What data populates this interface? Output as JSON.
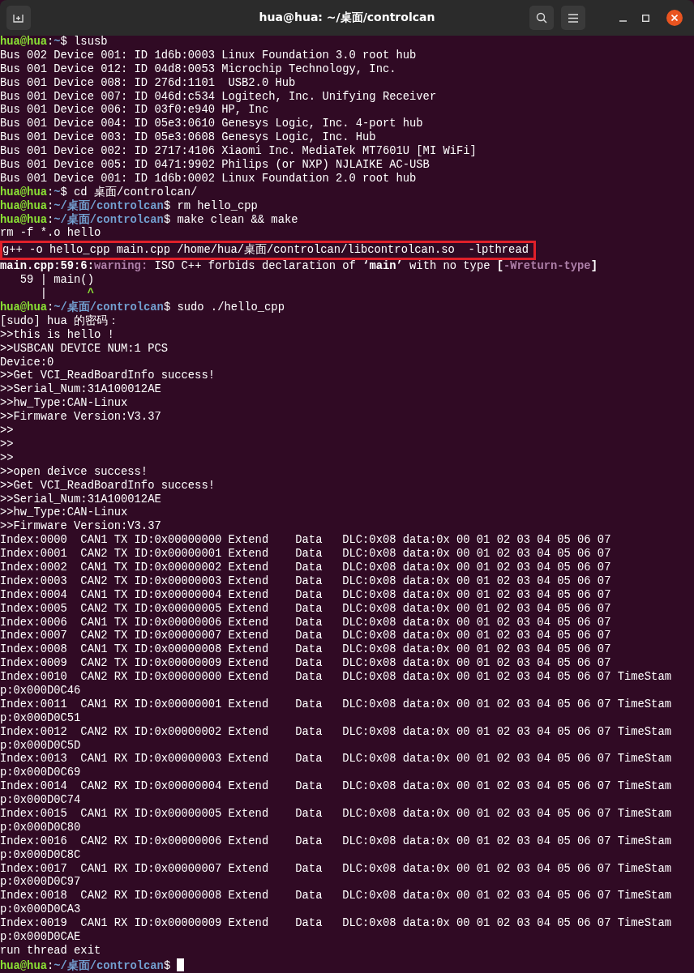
{
  "window": {
    "title": "hua@hua: ~/桌面/controlcan"
  },
  "terminal": {
    "lines": [
      {
        "kind": "prompt",
        "user": "hua@hua",
        "sep": ":",
        "path": "~",
        "symbol": "$ ",
        "command": "lsusb"
      },
      {
        "kind": "output",
        "text": "Bus 002 Device 001: ID 1d6b:0003 Linux Foundation 3.0 root hub"
      },
      {
        "kind": "output",
        "text": "Bus 001 Device 012: ID 04d8:0053 Microchip Technology, Inc."
      },
      {
        "kind": "output",
        "text": "Bus 001 Device 008: ID 276d:1101  USB2.0 Hub"
      },
      {
        "kind": "output",
        "text": "Bus 001 Device 007: ID 046d:c534 Logitech, Inc. Unifying Receiver"
      },
      {
        "kind": "output",
        "text": "Bus 001 Device 006: ID 03f0:e940 HP, Inc"
      },
      {
        "kind": "output",
        "text": "Bus 001 Device 004: ID 05e3:0610 Genesys Logic, Inc. 4-port hub"
      },
      {
        "kind": "output",
        "text": "Bus 001 Device 003: ID 05e3:0608 Genesys Logic, Inc. Hub"
      },
      {
        "kind": "output",
        "text": "Bus 001 Device 002: ID 2717:4106 Xiaomi Inc. MediaTek MT7601U [MI WiFi]"
      },
      {
        "kind": "output",
        "text": "Bus 001 Device 005: ID 0471:9902 Philips (or NXP) NJLAIKE AC-USB"
      },
      {
        "kind": "output",
        "text": "Bus 001 Device 001: ID 1d6b:0002 Linux Foundation 2.0 root hub"
      },
      {
        "kind": "prompt",
        "user": "hua@hua",
        "sep": ":",
        "path": "~",
        "symbol": "$ ",
        "command": "cd 桌面/controlcan/"
      },
      {
        "kind": "prompt",
        "user": "hua@hua",
        "sep": ":",
        "path": "~/桌面/controlcan",
        "symbol": "$ ",
        "command": "rm hello_cpp"
      },
      {
        "kind": "prompt",
        "user": "hua@hua",
        "sep": ":",
        "path": "~/桌面/controlcan",
        "symbol": "$ ",
        "command": "make clean && make"
      },
      {
        "kind": "output",
        "text": "rm -f *.o hello"
      },
      {
        "kind": "output",
        "text": "g++ -o hello_cpp main.cpp /home/hua/桌面/controlcan/libcontrolcan.so  -lpthread",
        "highlight": true
      },
      {
        "kind": "diagnostic",
        "location": "main.cpp:59:6:",
        "severity": "warning:",
        "message": " ISO C++ forbids declaration of **‘main’** with no type ",
        "flag_open": "[",
        "flag": "-Wreturn-type",
        "flag_close": "]"
      },
      {
        "kind": "output",
        "text": "   59 | main()"
      },
      {
        "kind": "caret",
        "gutter": "      |",
        "marker": "      ^"
      },
      {
        "kind": "prompt",
        "user": "hua@hua",
        "sep": ":",
        "path": "~/桌面/controlcan",
        "symbol": "$ ",
        "command": "sudo ./hello_cpp"
      },
      {
        "kind": "output",
        "text": "[sudo] hua 的密码："
      },
      {
        "kind": "output",
        "text": ">>this is hello !"
      },
      {
        "kind": "output",
        "text": ">>USBCAN DEVICE NUM:1 PCS"
      },
      {
        "kind": "output",
        "text": "Device:0"
      },
      {
        "kind": "output",
        "text": ">>Get VCI_ReadBoardInfo success!"
      },
      {
        "kind": "output",
        "text": ">>Serial_Num:31A100012AE"
      },
      {
        "kind": "output",
        "text": ">>hw_Type:CAN-Linux"
      },
      {
        "kind": "output",
        "text": ">>Firmware Version:V3.37"
      },
      {
        "kind": "output",
        "text": ">>"
      },
      {
        "kind": "output",
        "text": ">>"
      },
      {
        "kind": "output",
        "text": ">>"
      },
      {
        "kind": "output",
        "text": ">>open deivce success!"
      },
      {
        "kind": "output",
        "text": ">>Get VCI_ReadBoardInfo success!"
      },
      {
        "kind": "output",
        "text": ">>Serial_Num:31A100012AE"
      },
      {
        "kind": "output",
        "text": ">>hw_Type:CAN-Linux"
      },
      {
        "kind": "output",
        "text": ">>Firmware Version:V3.37"
      },
      {
        "kind": "output",
        "text": "Index:0000  CAN1 TX ID:0x00000000 Extend    Data   DLC:0x08 data:0x 00 01 02 03 04 05 06 07"
      },
      {
        "kind": "output",
        "text": "Index:0001  CAN2 TX ID:0x00000001 Extend    Data   DLC:0x08 data:0x 00 01 02 03 04 05 06 07"
      },
      {
        "kind": "output",
        "text": "Index:0002  CAN1 TX ID:0x00000002 Extend    Data   DLC:0x08 data:0x 00 01 02 03 04 05 06 07"
      },
      {
        "kind": "output",
        "text": "Index:0003  CAN2 TX ID:0x00000003 Extend    Data   DLC:0x08 data:0x 00 01 02 03 04 05 06 07"
      },
      {
        "kind": "output",
        "text": "Index:0004  CAN1 TX ID:0x00000004 Extend    Data   DLC:0x08 data:0x 00 01 02 03 04 05 06 07"
      },
      {
        "kind": "output",
        "text": "Index:0005  CAN2 TX ID:0x00000005 Extend    Data   DLC:0x08 data:0x 00 01 02 03 04 05 06 07"
      },
      {
        "kind": "output",
        "text": "Index:0006  CAN1 TX ID:0x00000006 Extend    Data   DLC:0x08 data:0x 00 01 02 03 04 05 06 07"
      },
      {
        "kind": "output",
        "text": "Index:0007  CAN2 TX ID:0x00000007 Extend    Data   DLC:0x08 data:0x 00 01 02 03 04 05 06 07"
      },
      {
        "kind": "output",
        "text": "Index:0008  CAN1 TX ID:0x00000008 Extend    Data   DLC:0x08 data:0x 00 01 02 03 04 05 06 07"
      },
      {
        "kind": "output",
        "text": "Index:0009  CAN2 TX ID:0x00000009 Extend    Data   DLC:0x08 data:0x 00 01 02 03 04 05 06 07"
      },
      {
        "kind": "output",
        "text": "Index:0010  CAN2 RX ID:0x00000000 Extend    Data   DLC:0x08 data:0x 00 01 02 03 04 05 06 07 TimeStam"
      },
      {
        "kind": "output",
        "text": "p:0x000D0C46"
      },
      {
        "kind": "output",
        "text": "Index:0011  CAN1 RX ID:0x00000001 Extend    Data   DLC:0x08 data:0x 00 01 02 03 04 05 06 07 TimeStam"
      },
      {
        "kind": "output",
        "text": "p:0x000D0C51"
      },
      {
        "kind": "output",
        "text": "Index:0012  CAN2 RX ID:0x00000002 Extend    Data   DLC:0x08 data:0x 00 01 02 03 04 05 06 07 TimeStam"
      },
      {
        "kind": "output",
        "text": "p:0x000D0C5D"
      },
      {
        "kind": "output",
        "text": "Index:0013  CAN1 RX ID:0x00000003 Extend    Data   DLC:0x08 data:0x 00 01 02 03 04 05 06 07 TimeStam"
      },
      {
        "kind": "output",
        "text": "p:0x000D0C69"
      },
      {
        "kind": "output",
        "text": "Index:0014  CAN2 RX ID:0x00000004 Extend    Data   DLC:0x08 data:0x 00 01 02 03 04 05 06 07 TimeStam"
      },
      {
        "kind": "output",
        "text": "p:0x000D0C74"
      },
      {
        "kind": "output",
        "text": "Index:0015  CAN1 RX ID:0x00000005 Extend    Data   DLC:0x08 data:0x 00 01 02 03 04 05 06 07 TimeStam"
      },
      {
        "kind": "output",
        "text": "p:0x000D0C80"
      },
      {
        "kind": "output",
        "text": "Index:0016  CAN2 RX ID:0x00000006 Extend    Data   DLC:0x08 data:0x 00 01 02 03 04 05 06 07 TimeStam"
      },
      {
        "kind": "output",
        "text": "p:0x000D0C8C"
      },
      {
        "kind": "output",
        "text": "Index:0017  CAN1 RX ID:0x00000007 Extend    Data   DLC:0x08 data:0x 00 01 02 03 04 05 06 07 TimeStam"
      },
      {
        "kind": "output",
        "text": "p:0x000D0C97"
      },
      {
        "kind": "output",
        "text": "Index:0018  CAN2 RX ID:0x00000008 Extend    Data   DLC:0x08 data:0x 00 01 02 03 04 05 06 07 TimeStam"
      },
      {
        "kind": "output",
        "text": "p:0x000D0CA3"
      },
      {
        "kind": "output",
        "text": "Index:0019  CAN1 RX ID:0x00000009 Extend    Data   DLC:0x08 data:0x 00 01 02 03 04 05 06 07 TimeStam"
      },
      {
        "kind": "output",
        "text": "p:0x000D0CAE"
      },
      {
        "kind": "output",
        "text": "run thread exit"
      },
      {
        "kind": "prompt",
        "user": "hua@hua",
        "sep": ":",
        "path": "~/桌面/controlcan",
        "symbol": "$ ",
        "cursor": true
      }
    ]
  }
}
